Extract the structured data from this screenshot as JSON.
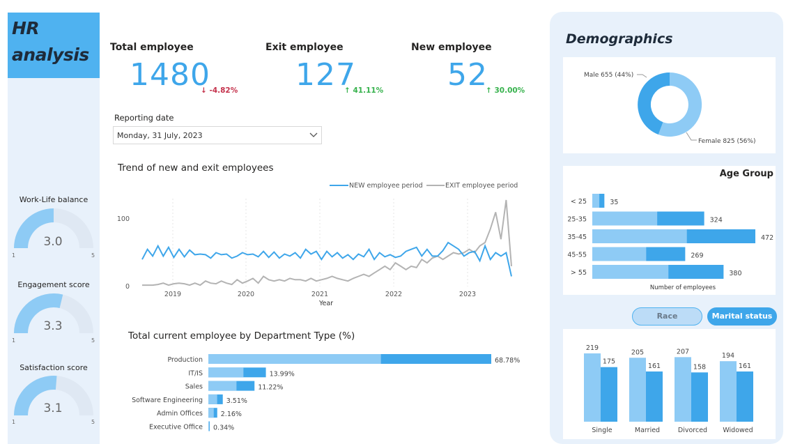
{
  "brand": {
    "line1": "HR",
    "line2": "analysis"
  },
  "gauges": [
    {
      "title": "Work-Life balance",
      "value": "3.0",
      "min": "1",
      "max": "5",
      "level": 3.0
    },
    {
      "title": "Engagement score",
      "value": "3.3",
      "min": "1",
      "max": "5",
      "level": 3.3
    },
    {
      "title": "Satisfaction score",
      "value": "3.1",
      "min": "1",
      "max": "5",
      "level": 3.1
    }
  ],
  "kpis": [
    {
      "label": "Total employee",
      "value": "1480",
      "delta": "-4.82%",
      "direction": "down",
      "delta_color": "#c4314b"
    },
    {
      "label": "Exit employee",
      "value": "127",
      "delta": "41.11%",
      "direction": "up",
      "delta_color": "#37b24d"
    },
    {
      "label": "New employee",
      "value": "52",
      "delta": "30.00%",
      "direction": "up",
      "delta_color": "#37b24d"
    }
  ],
  "reporting": {
    "label": "Reporting date",
    "value": "Monday, 31 July, 2023",
    "icon": "chevron-down-icon"
  },
  "colors": {
    "accent": "#3ea6ea",
    "accent_light": "#8ecbf5",
    "grey_line": "#b3b3b3",
    "panel": "#e8f1fb"
  },
  "demographics": {
    "title": "Demographics"
  },
  "toggle": {
    "race": "Race",
    "marital": "Marital status"
  },
  "chart_data": [
    {
      "type": "line",
      "title": "Trend of new and exit employees",
      "xlabel": "Year",
      "ylabel": "",
      "x_ticks": [
        "2019",
        "2020",
        "2021",
        "2022",
        "2023"
      ],
      "y_ticks": [
        "0",
        "100"
      ],
      "ylim": [
        0,
        130
      ],
      "legend": "top-right",
      "series": [
        {
          "name": "NEW employee period",
          "color": "#3ea6ea",
          "values": [
            40,
            55,
            45,
            60,
            45,
            58,
            43,
            55,
            44,
            54,
            47,
            48,
            47,
            42,
            50,
            47,
            48,
            42,
            45,
            50,
            47,
            48,
            44,
            52,
            43,
            51,
            42,
            48,
            45,
            50,
            42,
            55,
            48,
            52,
            40,
            52,
            44,
            50,
            42,
            47,
            40,
            48,
            44,
            55,
            40,
            50,
            44,
            47,
            43,
            45,
            52,
            55,
            58,
            45,
            55,
            45,
            45,
            53,
            65,
            60,
            55,
            45,
            50,
            52,
            38,
            60,
            40,
            50,
            45,
            50,
            15
          ]
        },
        {
          "name": "EXIT employee period",
          "color": "#b3b3b3",
          "values": [
            2,
            2,
            2,
            3,
            5,
            2,
            4,
            5,
            4,
            2,
            5,
            2,
            8,
            5,
            4,
            8,
            5,
            3,
            10,
            5,
            8,
            12,
            5,
            15,
            10,
            8,
            10,
            8,
            12,
            10,
            10,
            8,
            12,
            8,
            10,
            12,
            15,
            12,
            10,
            8,
            12,
            15,
            18,
            15,
            20,
            25,
            30,
            25,
            35,
            30,
            25,
            30,
            28,
            40,
            35,
            42,
            45,
            40,
            45,
            50,
            48,
            50,
            55,
            50,
            60,
            65,
            85,
            110,
            70,
            128,
            30
          ]
        }
      ]
    },
    {
      "type": "bar",
      "title": "Total current employee by Department Type (%)",
      "categories": [
        "Production",
        "IT/IS",
        "Sales",
        "Software Engineering",
        "Admin Offices",
        "Executive Office"
      ],
      "values": [
        68.78,
        13.99,
        11.22,
        3.51,
        2.16,
        0.34
      ],
      "labels": [
        "68.78%",
        "13.99%",
        "11.22%",
        "3.51%",
        "2.16%",
        "0.34%"
      ]
    },
    {
      "type": "pie",
      "categories": [
        "Male",
        "Female"
      ],
      "values": [
        655,
        825
      ],
      "labels": [
        "Male 655 (44%)",
        "Female 825 (56%)"
      ]
    },
    {
      "type": "bar",
      "title": "Age Group",
      "xlabel": "Number of employees",
      "categories": [
        "< 25",
        "25-35",
        "35-45",
        "45-55",
        "> 55"
      ],
      "values": [
        35,
        324,
        472,
        269,
        380
      ]
    },
    {
      "type": "bar",
      "categories": [
        "Single",
        "Married",
        "Divorced",
        "Widowed"
      ],
      "series": [
        {
          "values": [
            219,
            205,
            207,
            194
          ]
        },
        {
          "values": [
            175,
            161,
            158,
            161
          ]
        }
      ]
    }
  ]
}
